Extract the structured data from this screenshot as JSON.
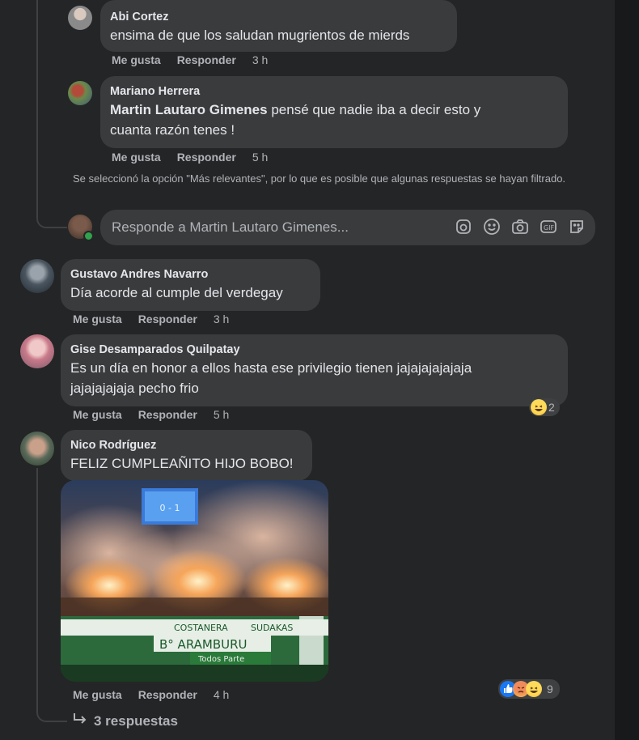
{
  "comments": [
    {
      "author": "Abi Cortez",
      "text": "ensima de que los saludan mugrientos de mierds",
      "like": "Me gusta",
      "reply": "Responder",
      "time": "3 h"
    },
    {
      "author": "Mariano Herrera",
      "mention": "Martin Lautaro Gimenes",
      "text_line1": " pensé que nadie iba a decir esto y",
      "text_line2": "cuanta razón tenes !",
      "like": "Me gusta",
      "reply": "Responder",
      "time": "5 h"
    },
    {
      "author": "Gustavo Andres Navarro",
      "text": "Día acorde al cumple del verdegay",
      "like": "Me gusta",
      "reply": "Responder",
      "time": "3 h"
    },
    {
      "author": "Gise Desamparados Quilpatay",
      "text_line1": "Es un día en honor a ellos hasta ese privilegio tienen jajajajajajaja",
      "text_line2": "jajajajajaja pecho frio",
      "reaction_count": "2",
      "like": "Me gusta",
      "reply": "Responder",
      "time": "5 h"
    },
    {
      "author": "Nico Rodríguez",
      "text": "FELIZ CUMPLEAÑITO HIJO BOBO!",
      "reaction_count": "9",
      "like": "Me gusta",
      "reply": "Responder",
      "time": "4 h",
      "photo_banners": [
        "COSTANERA",
        "SUDAKAS",
        "B° ARAMBURU",
        "Todos Parte"
      ]
    }
  ],
  "filter_note": "Se seleccionó la opción \"Más relevantes\", por lo que es posible que algunas respuestas se hayan filtrado.",
  "reply_box": {
    "placeholder": "Responde a Martin Lautaro Gimenes...",
    "icons": [
      "sticker-icon",
      "emoji-icon",
      "camera-icon",
      "gif-icon",
      "avatar-sticker-icon"
    ]
  },
  "view_replies": "3 respuestas",
  "colors": {
    "background": "#242526",
    "bubble": "#3a3b3c",
    "text": "#e4e6eb",
    "muted": "#b0b3b8",
    "like_blue": "#1877f2"
  }
}
